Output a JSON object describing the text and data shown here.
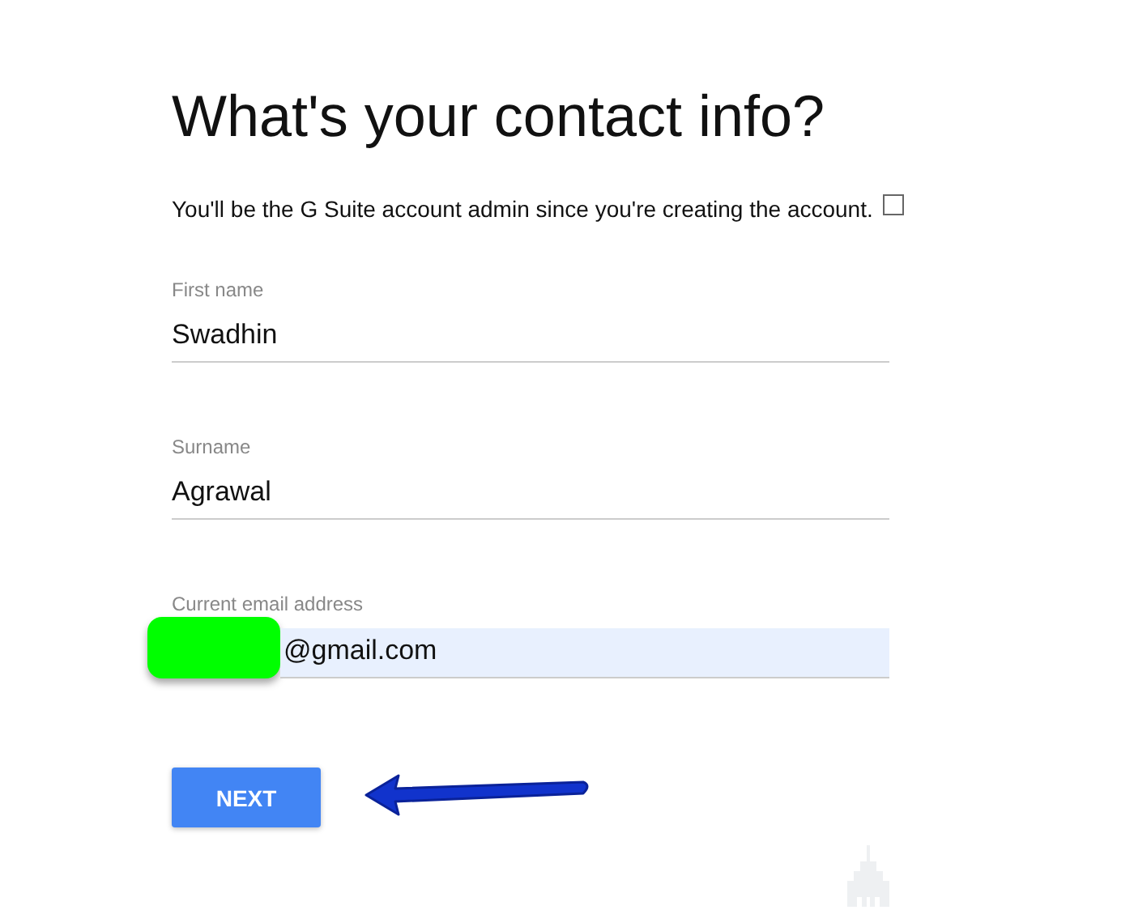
{
  "heading": "What's your contact info?",
  "admin_note": {
    "text": "You'll be the G Suite account admin since you're creating the account.",
    "checked": false
  },
  "fields": [
    {
      "label": "First name",
      "value": "Swadhin",
      "kind": "plain"
    },
    {
      "label": "Surname",
      "value": "Agrawal",
      "kind": "plain"
    },
    {
      "label": "Current email address",
      "value": "@gmail.com",
      "kind": "redacted"
    }
  ],
  "next_button": "NEXT"
}
